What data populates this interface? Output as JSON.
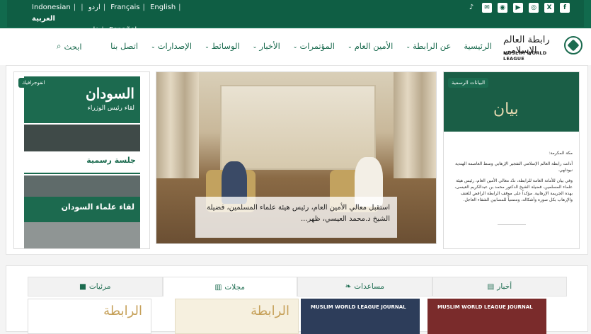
{
  "languages": {
    "arabic": "العربية",
    "english": "English",
    "french": "Français",
    "urdu": "اردو",
    "indonesian": "Indonesian",
    "spanish": "Español",
    "persian": "فارسي",
    "separator": "|"
  },
  "social_icons": [
    "facebook-icon",
    "instagram-icon",
    "youtube-icon",
    "rss-icon",
    "mail-icon",
    "x-icon",
    "tiktok-icon"
  ],
  "logo": {
    "arabic": "رابطة العالم الإسلامي",
    "english": "MUSLIM WORLD LEAGUE"
  },
  "nav": {
    "home": "الرئيسية",
    "about": "عن الرابطة",
    "secretary": "الأمين العام",
    "conferences": "المؤتمرات",
    "news": "الأخبار",
    "media": "الوسائط",
    "publications": "الإصدارات",
    "contact": "اتصل بنا",
    "search": "ابحث"
  },
  "hero": {
    "left_badge": "انفوجرافيك",
    "left_title": "السودان",
    "left_subtitle": "لقاء رئيس الوزراء",
    "left_mid": "جلسة رسمية",
    "left_bottom": "لقاء علماء السودان",
    "center_caption": "استقبل معالي الأمين العام، رئيس هيئة علماء المسلمين، فضيلة الشيخ د.محمد العيسي، ظهر...",
    "right_badge": "البيانات الرسمية",
    "right_calligraphy": "بيان",
    "right_text_1": "مكة المكرمة:",
    "right_text_2": "أدانت رابطة العالم الإسلامي التفجير الإرهابي وسط العاصمة الهندية نيودلهي.",
    "right_text_3": "وفي بيان للأمانة العامة للرابطة، ندّد معالي الأمين العام، رئيس هيئة علماء المسلمين، فضيلة الشيخ الدكتور محمد بن عبدالكريم العيسى، بهذه الجريمة الإرهابية. مؤكداً على موقف الرابطة الرافض للعنف والإرهاب بكل صوره وأشكاله، ومتمنياً للمصابين الشفاء العاجل."
  },
  "tabs": {
    "news": "أخبار",
    "aid": "مساعدات",
    "magazines": "مجلات",
    "videos": "مرئيات"
  },
  "thumbs": {
    "journal_1": "MUSLIM WORLD LEAGUE JOURNAL",
    "journal_2": "MUSLIM WORLD LEAGUE JOURNAL",
    "arabic_mag": "الرابطة",
    "arabic_mag2": "الرابطة"
  },
  "colors": {
    "brand": "#116a4d",
    "accent_gold": "#c6a15a"
  }
}
